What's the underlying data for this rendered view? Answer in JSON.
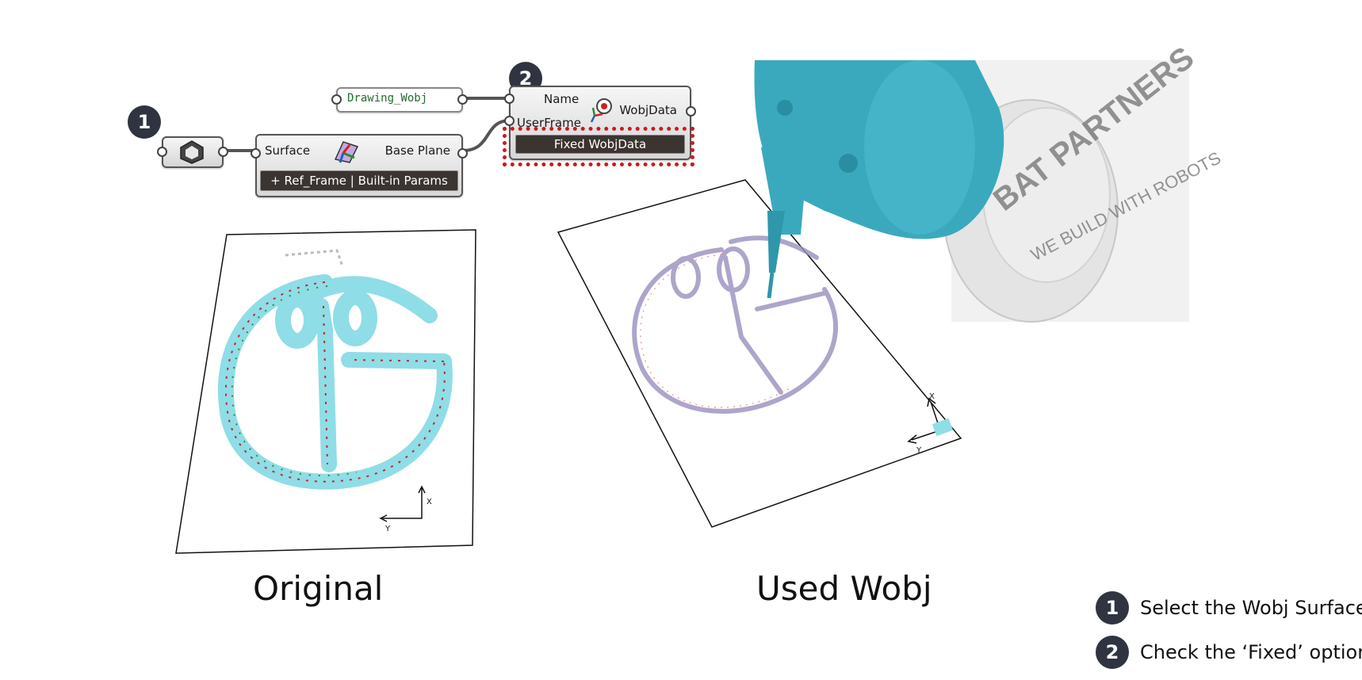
{
  "grasshopper": {
    "surface_param": {
      "icon": "hexagon-surface-icon"
    },
    "ref_frame": {
      "input_label": "Surface",
      "output_label": "Base Plane",
      "footer": "+ Ref_Frame | Built-in Params",
      "icon": "reference-frame-icon"
    },
    "name_panel": {
      "value": "Drawing_Wobj"
    },
    "wobj": {
      "input_name": "Name",
      "input_userframe": "UserFrame",
      "output_label": "WobjData",
      "footer": "Fixed WobjData",
      "icon": "target-frame-icon"
    }
  },
  "badges": {
    "one": "1",
    "two": "2"
  },
  "captions": {
    "original": "Original",
    "used_wobj": "Used Wobj"
  },
  "legend": [
    {
      "number": "1",
      "text": "Select the Wobj Surface"
    },
    {
      "number": "2",
      "text": "Check the ‘Fixed’ option"
    }
  ],
  "robot": {
    "brand_line1": "BAT PARTNERS",
    "brand_line2": "WE BUILD WITH ROBOTS"
  },
  "axis_labels": {
    "x": "X",
    "y": "Y"
  },
  "colors": {
    "robot_teal": "#3aa9be",
    "highlight_red": "#d0171b",
    "badge": "#2f3440",
    "toolpath_cyan": "#7fd3de"
  }
}
